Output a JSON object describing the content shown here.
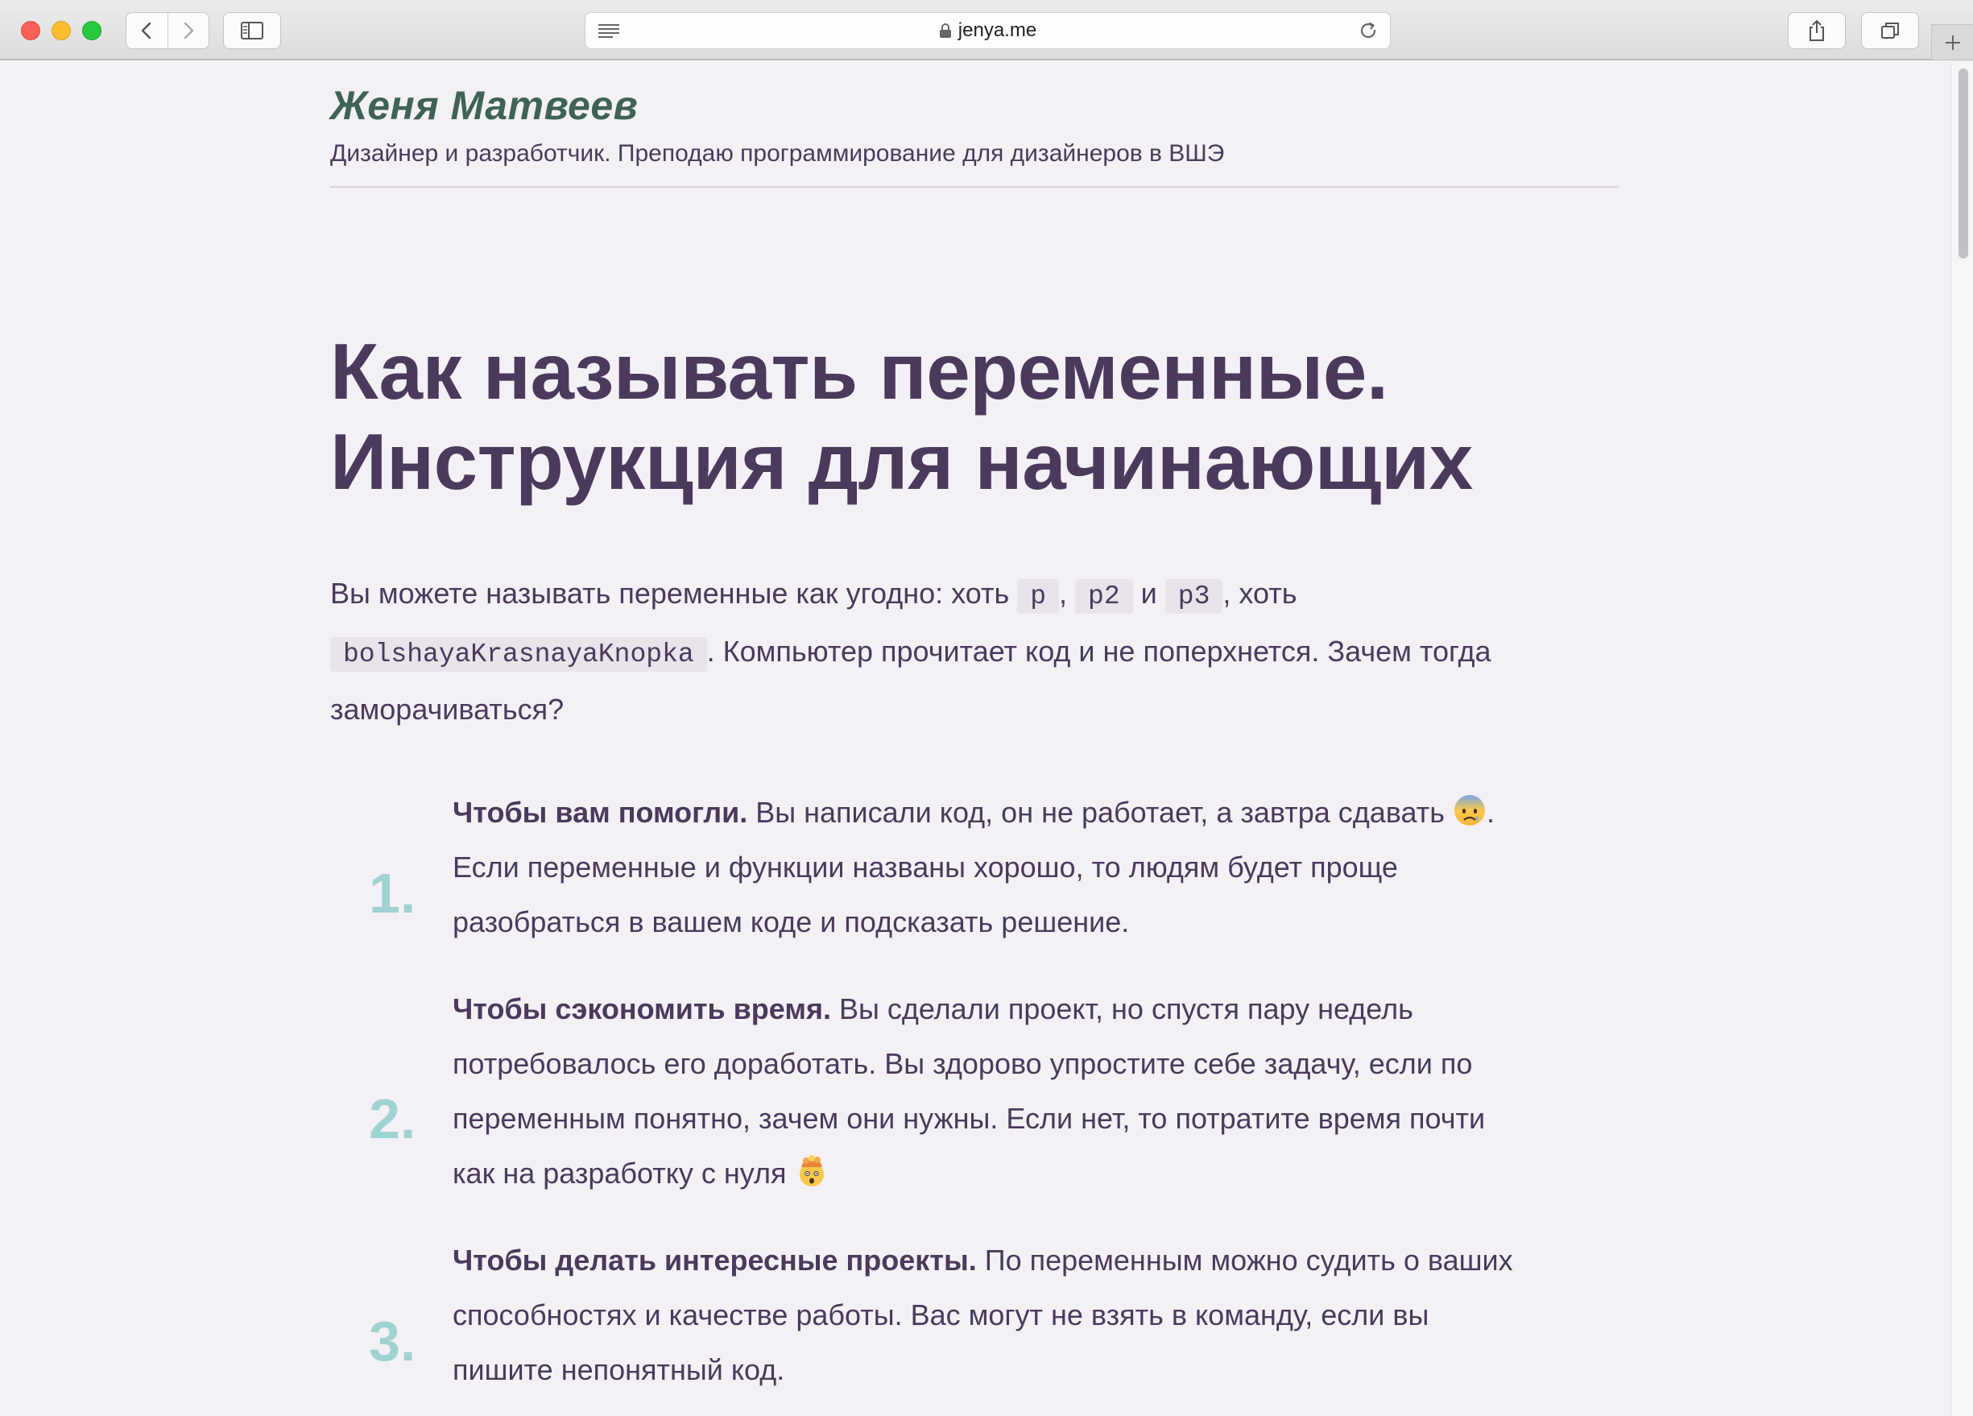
{
  "browser": {
    "url": "jenya.me"
  },
  "site": {
    "title": "Женя Матвеев",
    "subtitle": "Дизайнер и разработчик. Преподаю программирование для дизайнеров в ВШЭ"
  },
  "article": {
    "title_line1": "Как называть переменные.",
    "title_line2": "Инструкция для начинающих",
    "intro": {
      "t1": "Вы можете называть переменные как угодно: хоть ",
      "c1": "p",
      "t2": ", ",
      "c2": "p2",
      "t3": " и ",
      "c3": "p3",
      "t4": ", хоть ",
      "c4": "bolshayaKrasnayaKnopka",
      "t5": ". Компьютер прочитает код и не поперхнется. Зачем тогда заморачиваться?"
    },
    "reasons": [
      {
        "number": "1.",
        "bold": "Чтобы вам помогли.",
        "text_a": " Вы написали код, он не работает, а завтра сдавать ",
        "emoji": "anxious-face-icon",
        "text_b": ". Если переменные и функции названы хорошо, то людям будет проще разобраться в вашем коде и подсказать решение."
      },
      {
        "number": "2.",
        "bold": "Чтобы сэкономить время.",
        "text_a": " Вы сделали проект, но спустя пару недель потребовалось его доработать. Вы здорово упростите себе задачу, если по переменным понятно, зачем они нужны. Если нет, то потратите время почти как на разработку с нуля ",
        "emoji": "exploding-head-icon",
        "text_b": ""
      },
      {
        "number": "3.",
        "bold": "Чтобы делать интересные проекты.",
        "text_a": " По переменным можно судить о ваших способностях и качестве работы. Вас могут не взять в команду, если вы пишите непонятный код.",
        "emoji": "",
        "text_b": ""
      }
    ]
  },
  "colors": {
    "background": "#f4f1f6",
    "text": "#4a3a5c",
    "site_title": "#3f6356",
    "list_number": "#9fd3d0",
    "code_bg": "#e8e4ea"
  }
}
